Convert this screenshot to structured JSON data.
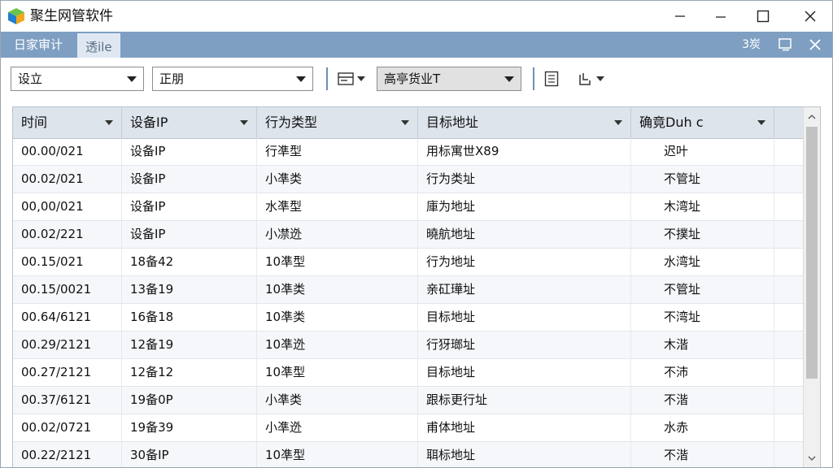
{
  "window": {
    "title": "聚生网管软件"
  },
  "tabs": [
    {
      "label": "日家审计"
    },
    {
      "label": "透ile"
    }
  ],
  "tabbar_right": {
    "label": "3炭"
  },
  "toolbar": {
    "combo1": "设立",
    "combo2": "正朋",
    "combo3": "高亭货业T"
  },
  "columns": [
    {
      "label": "时间"
    },
    {
      "label": "设备IP"
    },
    {
      "label": "行为类型"
    },
    {
      "label": "目标地址"
    },
    {
      "label": "确竟Duh c"
    }
  ],
  "rows": [
    [
      "00.00/021",
      "设备IP",
      "行凖型",
      "用标寓世X89",
      "迟叶"
    ],
    [
      "00.02/021",
      "设备IP",
      "小凖类",
      "行为类址",
      "不管址"
    ],
    [
      "00,00/021",
      "设备IP",
      "水凖型",
      "庫为地址",
      "木湾址"
    ],
    [
      "00.02/221",
      "设备IP",
      "小凚迯",
      "曉航地址",
      "不撲址"
    ],
    [
      "00.15/021",
      "18备42",
      "10凖型",
      "行为地址",
      "水湾址"
    ],
    [
      "00.15/0021",
      "13备19",
      "10凖类",
      "亲矼璍址",
      "不管址"
    ],
    [
      "00.64/6121",
      "16备18",
      "10凖类",
      "目标地址",
      "不湾址"
    ],
    [
      "00.29/2121",
      "12备19",
      "10凖迯",
      "行犽瑯址",
      "木湝"
    ],
    [
      "00.27/2121",
      "12备12",
      "10凖型",
      "目标地址",
      "不沛"
    ],
    [
      "00.37/6121",
      "19备0P",
      "小凖类",
      "跟标更行址",
      "不湝"
    ],
    [
      "00.02/0721",
      "19备39",
      "小凖迯",
      "甫体地址",
      "水赤"
    ],
    [
      "00.22/2121",
      "30备IP",
      "10凖型",
      "聑标地址",
      "不湝"
    ]
  ],
  "colors": {
    "tabbar": "#7f9fc2",
    "header": "#dde4ec",
    "row_alt": "#f5f7fa"
  }
}
